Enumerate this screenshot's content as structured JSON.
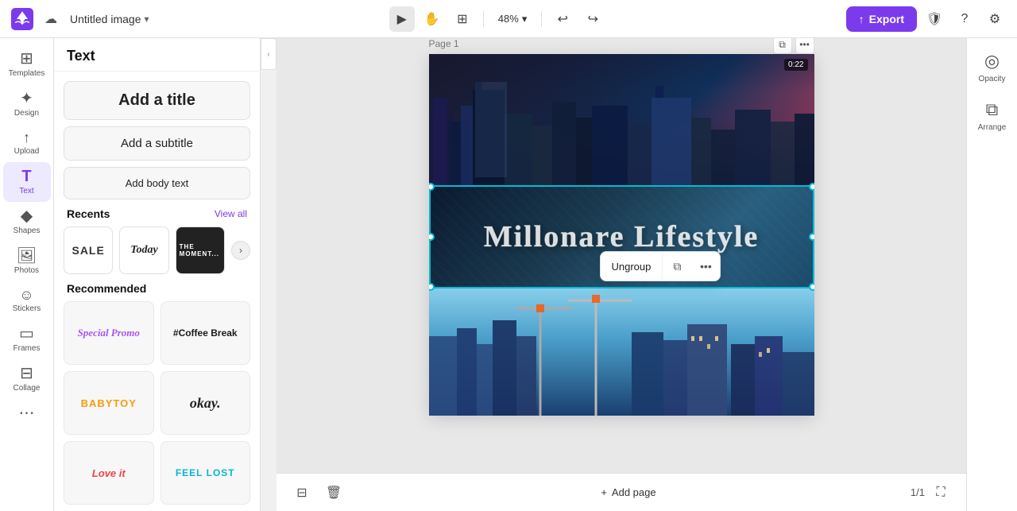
{
  "app": {
    "logo_label": "Canva",
    "doc_title": "Untitled image",
    "doc_title_chevron": "▾"
  },
  "topbar": {
    "upload_icon": "☁",
    "presentation_icon": "▶",
    "hand_icon": "✋",
    "layout_icon": "⊞",
    "zoom_label": "48%",
    "zoom_chevron": "▾",
    "undo_icon": "↩",
    "redo_icon": "↪",
    "export_icon": "↑",
    "export_label": "Export",
    "shield_icon": "🛡",
    "help_icon": "?",
    "settings_icon": "⚙"
  },
  "sidebar": {
    "items": [
      {
        "id": "templates",
        "icon": "⊞",
        "label": "Templates"
      },
      {
        "id": "design",
        "icon": "✦",
        "label": "Design"
      },
      {
        "id": "upload",
        "icon": "↑",
        "label": "Upload"
      },
      {
        "id": "text",
        "icon": "T",
        "label": "Text"
      },
      {
        "id": "shapes",
        "icon": "◆",
        "label": "Shapes"
      },
      {
        "id": "photos",
        "icon": "🖼",
        "label": "Photos"
      },
      {
        "id": "stickers",
        "icon": "☺",
        "label": "Stickers"
      },
      {
        "id": "frames",
        "icon": "▭",
        "label": "Frames"
      },
      {
        "id": "collage",
        "icon": "⊟",
        "label": "Collage"
      }
    ]
  },
  "text_panel": {
    "title": "Text",
    "add_title_label": "Add a title",
    "add_subtitle_label": "Add a subtitle",
    "add_body_label": "Add body text",
    "recents_label": "Recents",
    "view_all_label": "View all",
    "recent_items": [
      {
        "id": "sale",
        "label": "SALE"
      },
      {
        "id": "today",
        "label": "Today"
      },
      {
        "id": "moment",
        "label": "THE MOMENT..."
      }
    ],
    "recommended_label": "Recommended",
    "recommended_items": [
      {
        "id": "special-promo",
        "label": "Special Promo"
      },
      {
        "id": "coffee-break",
        "label": "#Coffee Break"
      },
      {
        "id": "babytoy",
        "label": "BABYTOY"
      },
      {
        "id": "okay",
        "label": "okay."
      },
      {
        "id": "love-it",
        "label": "Love it"
      },
      {
        "id": "feel-lost",
        "label": "FEEL LOST"
      }
    ]
  },
  "canvas": {
    "page_label": "Page 1",
    "video_time": "0:22",
    "overlay_text": "Millonare Lifestyle",
    "context_menu": {
      "ungroup_label": "Ungroup",
      "copy_icon": "⧉",
      "more_icon": "•••"
    }
  },
  "bottom_bar": {
    "grid_icon": "⊟",
    "trash_icon": "🗑",
    "add_page_icon": "+",
    "add_page_label": "Add page",
    "page_count": "1/1",
    "fullscreen_icon": "⛶"
  },
  "right_sidebar": {
    "opacity_label": "Opacity",
    "arrange_label": "Arrange"
  }
}
